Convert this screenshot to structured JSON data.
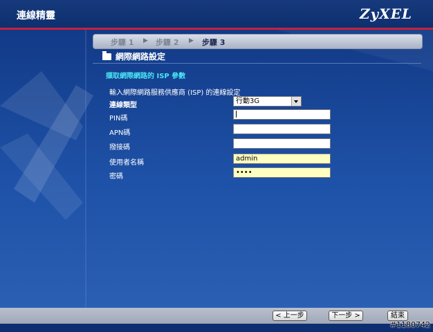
{
  "window": {
    "title": "連線精靈",
    "logo": "ZyXEL"
  },
  "steps": [
    {
      "label": "步驟 1",
      "active": false
    },
    {
      "label": "步驟 2",
      "active": false
    },
    {
      "label": "步驟 3",
      "active": true
    }
  ],
  "section": {
    "title": "網際網路設定"
  },
  "subtitle": "擷取網際網路的 ISP 參數",
  "instruction": "輸入網際網路服務供應商 (ISP) 的連線設定",
  "form": {
    "connection_type": {
      "label": "連線類型",
      "value": "行動3G"
    },
    "pin": {
      "label": "PIN碼",
      "value": ""
    },
    "apn": {
      "label": "APN碼",
      "value": ""
    },
    "dial": {
      "label": "撥接碼",
      "value": ""
    },
    "username": {
      "label": "使用者名稱",
      "value": "admin"
    },
    "password": {
      "label": "密碼",
      "value": "••••"
    }
  },
  "buttons": {
    "back": "< 上一步",
    "next": "下一步 >",
    "finish": "結束"
  },
  "watermark": "#1180742",
  "colors": {
    "header_bg": "#0e2f6f",
    "accent_red": "#c8213a",
    "subtitle_cyan": "#49e4f2",
    "field_yellow": "#ffffc2"
  }
}
